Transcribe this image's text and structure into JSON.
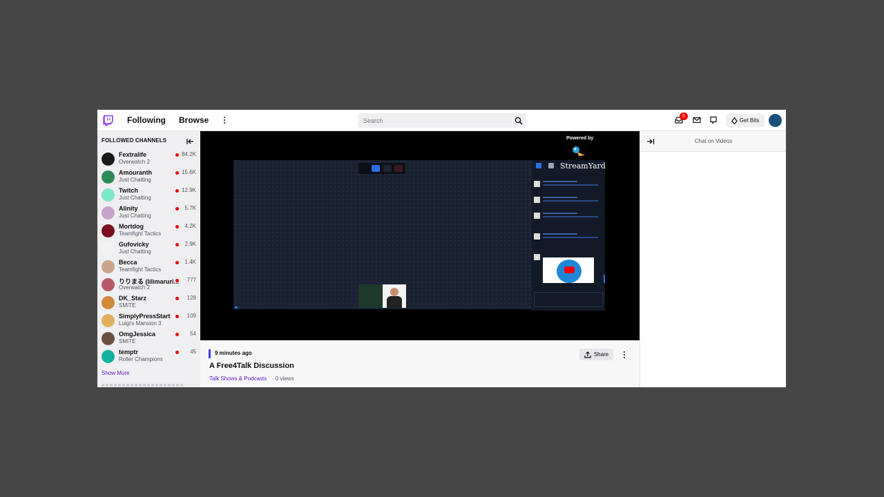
{
  "topnav": {
    "following": "Following",
    "browse": "Browse",
    "search_placeholder": "Search",
    "notification_count": "5",
    "get_bits": "Get Bits"
  },
  "sidebar": {
    "header": "FOLLOWED CHANNELS",
    "channels": [
      {
        "name": "Fextralife",
        "game": "Overwatch 2",
        "viewers": "84.2K",
        "color": "#1a1a1a"
      },
      {
        "name": "Amouranth",
        "game": "Just Chatting",
        "viewers": "15.6K",
        "color": "#2e8b57"
      },
      {
        "name": "Twitch",
        "game": "Just Chatting",
        "viewers": "12.9K",
        "color": "#7ee8c8"
      },
      {
        "name": "Alinity",
        "game": "Just Chatting",
        "viewers": "5.7K",
        "color": "#c9a2c9"
      },
      {
        "name": "Mortdog",
        "game": "Teamfight Tactics",
        "viewers": "4.2K",
        "color": "#7a1020"
      },
      {
        "name": "Gufovicky",
        "game": "Just Chatting",
        "viewers": "2.9K",
        "color": "#f2f2f2"
      },
      {
        "name": "Becca",
        "game": "Teamfight Tactics",
        "viewers": "1.4K",
        "color": "#c8a58a"
      },
      {
        "name": "りりまる (lilimaruri...",
        "game": "Overwatch 2",
        "viewers": "777",
        "color": "#b85a6a"
      },
      {
        "name": "DK_Starz",
        "game": "SMITE",
        "viewers": "128",
        "color": "#d08a3a"
      },
      {
        "name": "SimplyPressStart",
        "game": "Luigi's Mansion 3",
        "viewers": "109",
        "color": "#e0b060"
      },
      {
        "name": "OmgJessica",
        "game": "SMITE",
        "viewers": "54",
        "color": "#6a5040"
      },
      {
        "name": "temptr",
        "game": "Roller Champions",
        "viewers": "45",
        "color": "#16b0a0"
      }
    ],
    "show_more": "Show More"
  },
  "player": {
    "powered_by": "Powered by",
    "logo_text": "StreamYard"
  },
  "video_info": {
    "time_ago": "9 minutes ago",
    "title": "A Free4Talk Discussion",
    "category": "Talk Shows & Podcasts",
    "views": "· 0 views",
    "share": "Share"
  },
  "chat": {
    "title": "Chat on Videos"
  },
  "colors": {
    "brand": "#9146ff",
    "live": "#eb0400",
    "link": "#5c16c5"
  }
}
